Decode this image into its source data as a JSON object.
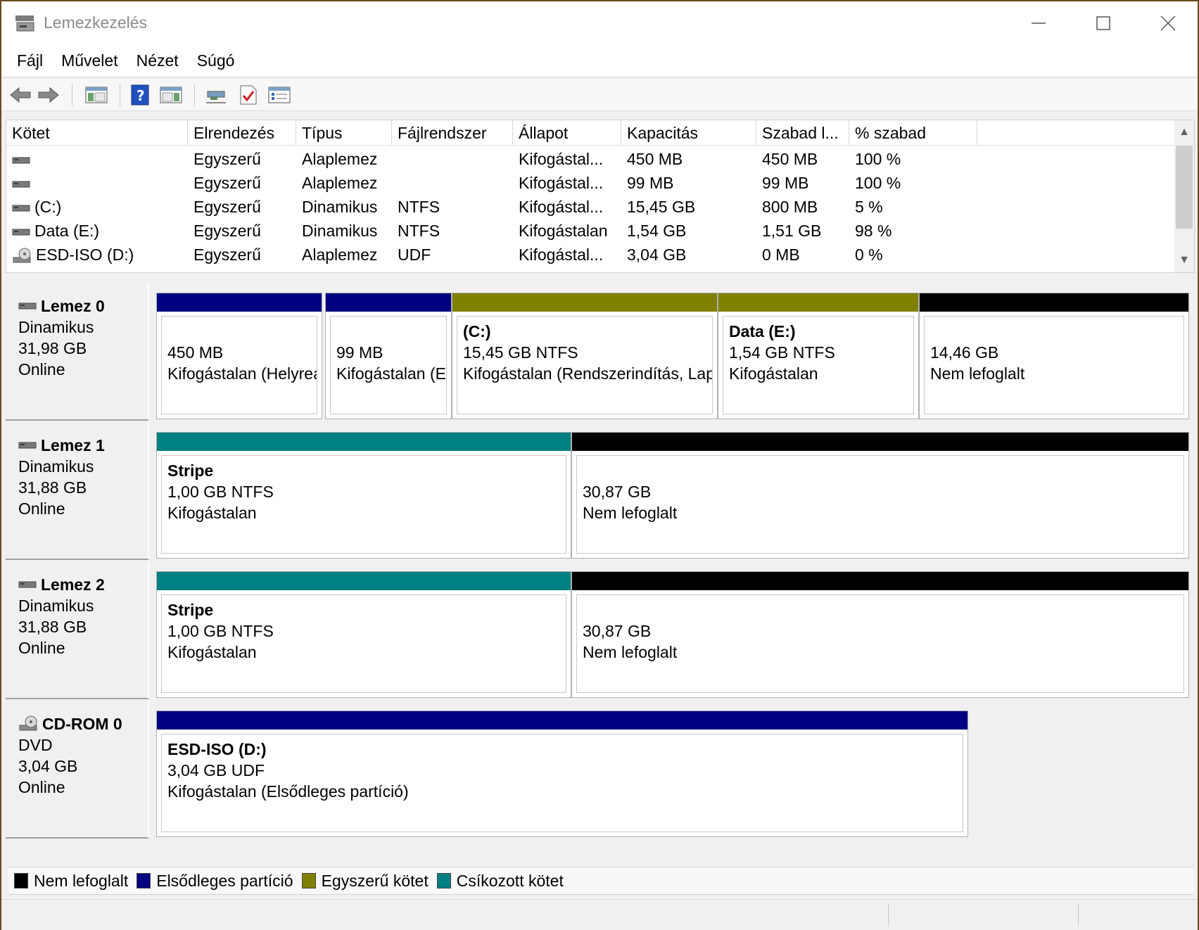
{
  "window": {
    "title": "Lemezkezelés"
  },
  "menu": [
    "Fájl",
    "Művelet",
    "Nézet",
    "Súgó"
  ],
  "toolbar": {
    "buttons": [
      "back-arrow-icon",
      "forward-arrow-icon",
      "console-tree-icon",
      "help-icon",
      "action-pane-icon",
      "connect-icon",
      "check-icon",
      "properties-icon"
    ]
  },
  "volume_list": {
    "columns": [
      "Kötet",
      "Elrendezés",
      "Típus",
      "Fájlrendszer",
      "Állapot",
      "Kapacitás",
      "Szabad l...",
      "% szabad"
    ],
    "rows": [
      {
        "icon": "drive-icon",
        "volume": "",
        "layout": "Egyszerű",
        "type": "Alaplemez",
        "fs": "",
        "status": "Kifogástal...",
        "capacity": "450 MB",
        "free": "450 MB",
        "pct": "100 %"
      },
      {
        "icon": "drive-icon",
        "volume": "",
        "layout": "Egyszerű",
        "type": "Alaplemez",
        "fs": "",
        "status": "Kifogástal...",
        "capacity": "99 MB",
        "free": "99 MB",
        "pct": "100 %"
      },
      {
        "icon": "drive-icon",
        "volume": "(C:)",
        "layout": "Egyszerű",
        "type": "Dinamikus",
        "fs": "NTFS",
        "status": "Kifogástal...",
        "capacity": "15,45 GB",
        "free": "800 MB",
        "pct": "5 %"
      },
      {
        "icon": "drive-icon",
        "volume": "Data (E:)",
        "layout": "Egyszerű",
        "type": "Dinamikus",
        "fs": "NTFS",
        "status": "Kifogástalan",
        "capacity": "1,54 GB",
        "free": "1,51 GB",
        "pct": "98 %"
      },
      {
        "icon": "cdrom-icon",
        "volume": "ESD-ISO (D:)",
        "layout": "Egyszerű",
        "type": "Alaplemez",
        "fs": "UDF",
        "status": "Kifogástal...",
        "capacity": "3,04 GB",
        "free": "0 MB",
        "pct": "0 %"
      }
    ]
  },
  "disks": [
    {
      "name": "Lemez 0",
      "kind": "Dinamikus",
      "size": "31,98 GB",
      "state": "Online",
      "partitions": [
        {
          "bar": "#000080",
          "title": "",
          "line1": "450 MB",
          "line2": "Kifogástalan (Helyreállítási partíció)"
        },
        {
          "bar": "#000080",
          "title": "",
          "line1": "99 MB",
          "line2": "Kifogástalan (EFI rendszerpartíció)"
        },
        {
          "bar": "#808000",
          "title": "(C:)",
          "line1": "15,45 GB NTFS",
          "line2": "Kifogástalan (Rendszerindítás, Lapozófájl)"
        },
        {
          "bar": "#808000",
          "title": "Data  (E:)",
          "line1": "1,54 GB NTFS",
          "line2": "Kifogástalan"
        },
        {
          "bar": "#000000",
          "title": "",
          "line1": "14,46 GB",
          "line2": "Nem lefoglalt"
        }
      ]
    },
    {
      "name": "Lemez 1",
      "kind": "Dinamikus",
      "size": "31,88 GB",
      "state": "Online",
      "partitions": [
        {
          "bar": "#008080",
          "title": "Stripe",
          "line1": "1,00 GB NTFS",
          "line2": "Kifogástalan"
        },
        {
          "bar": "#000000",
          "title": "",
          "line1": "30,87 GB",
          "line2": "Nem lefoglalt"
        }
      ]
    },
    {
      "name": "Lemez 2",
      "kind": "Dinamikus",
      "size": "31,88 GB",
      "state": "Online",
      "partitions": [
        {
          "bar": "#008080",
          "title": "Stripe",
          "line1": "1,00 GB NTFS",
          "line2": "Kifogástalan"
        },
        {
          "bar": "#000000",
          "title": "",
          "line1": "30,87 GB",
          "line2": "Nem lefoglalt"
        }
      ]
    },
    {
      "name": "CD-ROM 0",
      "kind": "DVD",
      "size": "3,04 GB",
      "state": "Online",
      "partitions": [
        {
          "bar": "#000080",
          "title": "ESD-ISO  (D:)",
          "line1": "3,04 GB UDF",
          "line2": "Kifogástalan (Elsődleges partíció)"
        }
      ]
    }
  ],
  "legend": [
    {
      "color": "#000000",
      "label": "Nem lefoglalt"
    },
    {
      "color": "#000080",
      "label": "Elsődleges partíció"
    },
    {
      "color": "#808000",
      "label": "Egyszerű kötet"
    },
    {
      "color": "#008080",
      "label": "Csíkozott kötet"
    }
  ]
}
